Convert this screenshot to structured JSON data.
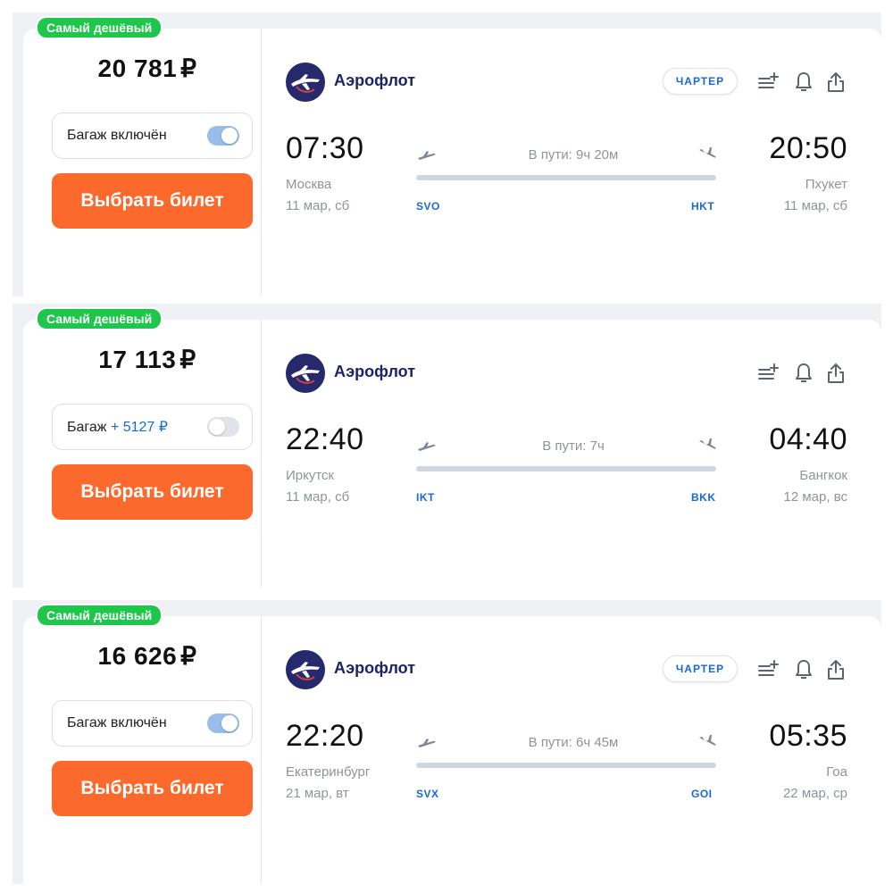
{
  "colors": {
    "badge": "#1ec74b",
    "button": "#fb6a2c",
    "airline_text": "#1c2466",
    "airport_code": "#1869d6",
    "toggle_on": "#98bde8"
  },
  "cards": [
    {
      "badge": "Самый дешёвый",
      "price": "20 781",
      "currency": "₽",
      "baggage_label": "Багаж включён",
      "baggage_extra": "",
      "baggage_toggle": "on",
      "buy_label": "Выбрать билет",
      "airline": "Аэрофлот",
      "charter": "ЧАРТЕР",
      "dep_time": "07:30",
      "dep_city": "Москва",
      "dep_date": "11 мар, сб",
      "dep_code": "SVO",
      "duration": "В пути: 9ч 20м",
      "arr_time": "20:50",
      "arr_city": "Пхукет",
      "arr_date": "11 мар, сб",
      "arr_code": "HKT",
      "icons": [
        "filter-add-icon",
        "bell-icon",
        "share-icon"
      ]
    },
    {
      "badge": "Самый дешёвый",
      "price": "17 113",
      "currency": "₽",
      "baggage_label": "Багаж",
      "baggage_extra": "+ 5127 ₽",
      "baggage_toggle": "off",
      "buy_label": "Выбрать билет",
      "airline": "Аэрофлот",
      "charter": "",
      "dep_time": "22:40",
      "dep_city": "Иркутск",
      "dep_date": "11 мар, сб",
      "dep_code": "IKT",
      "duration": "В пути: 7ч",
      "arr_time": "04:40",
      "arr_city": "Бангкок",
      "arr_date": "12 мар, вс",
      "arr_code": "BKK",
      "icons": [
        "filter-add-icon",
        "bell-icon",
        "share-icon"
      ]
    },
    {
      "badge": "Самый дешёвый",
      "price": "16 626",
      "currency": "₽",
      "baggage_label": "Багаж включён",
      "baggage_extra": "",
      "baggage_toggle": "on",
      "buy_label": "Выбрать билет",
      "airline": "Аэрофлот",
      "charter": "ЧАРТЕР",
      "dep_time": "22:20",
      "dep_city": "Екатеринбург",
      "dep_date": "21 мар, вт",
      "dep_code": "SVX",
      "duration": "В пути: 6ч 45м",
      "arr_time": "05:35",
      "arr_city": "Гоа",
      "arr_date": "22 мар, ср",
      "arr_code": "GOI",
      "icons": [
        "filter-add-icon",
        "bell-icon",
        "share-icon"
      ]
    }
  ]
}
